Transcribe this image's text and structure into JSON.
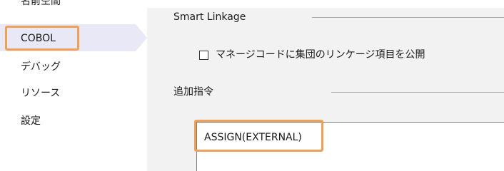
{
  "sidebar": {
    "items": [
      {
        "label": "名前空間"
      },
      {
        "label": "COBOL"
      },
      {
        "label": "デバッグ"
      },
      {
        "label": "リソース"
      },
      {
        "label": "設定"
      }
    ]
  },
  "panel": {
    "smart_linkage": {
      "title": "Smart Linkage",
      "checkbox_label": "マネージコードに集団のリンケージ項目を公開",
      "checked": false
    },
    "additional_directives": {
      "title": "追加指令",
      "value": "ASSIGN(EXTERNAL)"
    }
  },
  "colors": {
    "highlight": "#f0a055",
    "selected_bg": "#e8e8f6",
    "panel_bg": "#f2f2f2"
  }
}
